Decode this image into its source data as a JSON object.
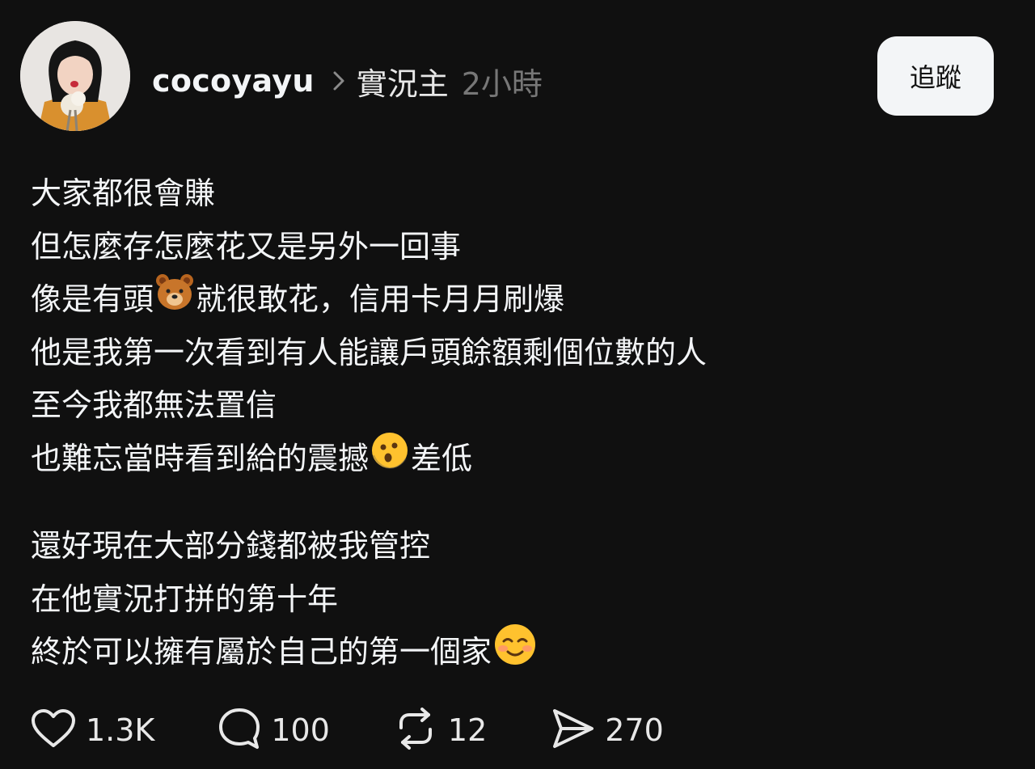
{
  "post": {
    "author": "cocoyayu",
    "topic": "實況主",
    "time_ago": "2小時",
    "follow_label": "追蹤",
    "lines": {
      "l1": "大家都很會賺",
      "l2": "但怎麼存怎麼花又是另外一回事",
      "l3a": "像是有頭",
      "l3b": "就很敢花，信用卡月月刷爆",
      "l4": "他是我第一次看到有人能讓戶頭餘額剩個位數的人",
      "l5": "至今我都無法置信",
      "l6a": "也難忘當時看到給的震撼",
      "l6b": "差低",
      "l7": "還好現在大部分錢都被我管控",
      "l8": "在他實況打拼的第十年",
      "l9": "終於可以擁有屬於自己的第一個家"
    },
    "emojis": {
      "bear": "bear-face-emoji",
      "surprised": "hushed-face-emoji",
      "smiling": "smiling-face-emoji"
    }
  },
  "actions": {
    "likes": "1.3K",
    "comments": "100",
    "reposts": "12",
    "shares": "270"
  },
  "colors": {
    "background": "#101010",
    "text": "#f3f5f7",
    "muted": "#777777",
    "button_bg": "#f3f5f7"
  }
}
